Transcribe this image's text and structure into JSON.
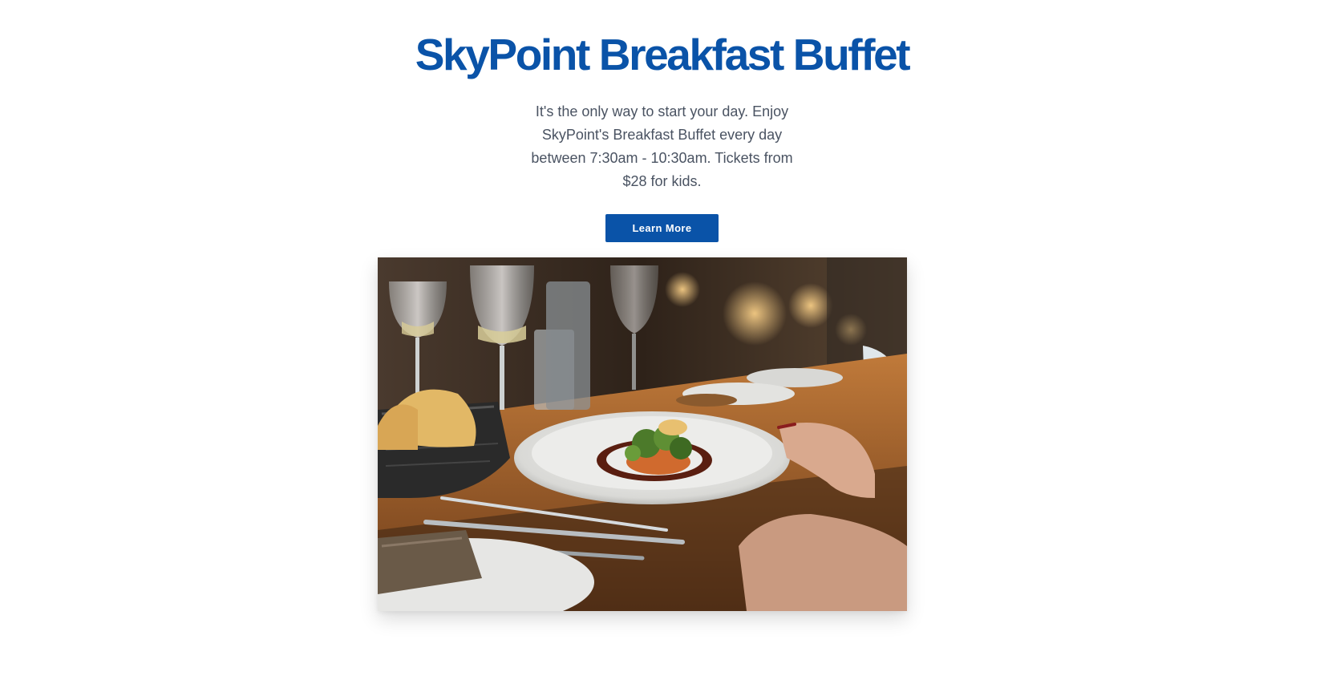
{
  "hero": {
    "title": "SkyPoint Breakfast Buffet",
    "description": "It's the only way to start your day. Enjoy SkyPoint's Breakfast Buffet every day between 7:30am - 10:30am. Tickets from $28 for kids.",
    "cta_label": "Learn More"
  },
  "photo": {
    "subject": "restaurant dining table with plated dish, wine glasses and bread basket"
  },
  "colors": {
    "brand_blue": "#0a53a8",
    "body_text": "#4a5362",
    "background": "#ffffff"
  }
}
